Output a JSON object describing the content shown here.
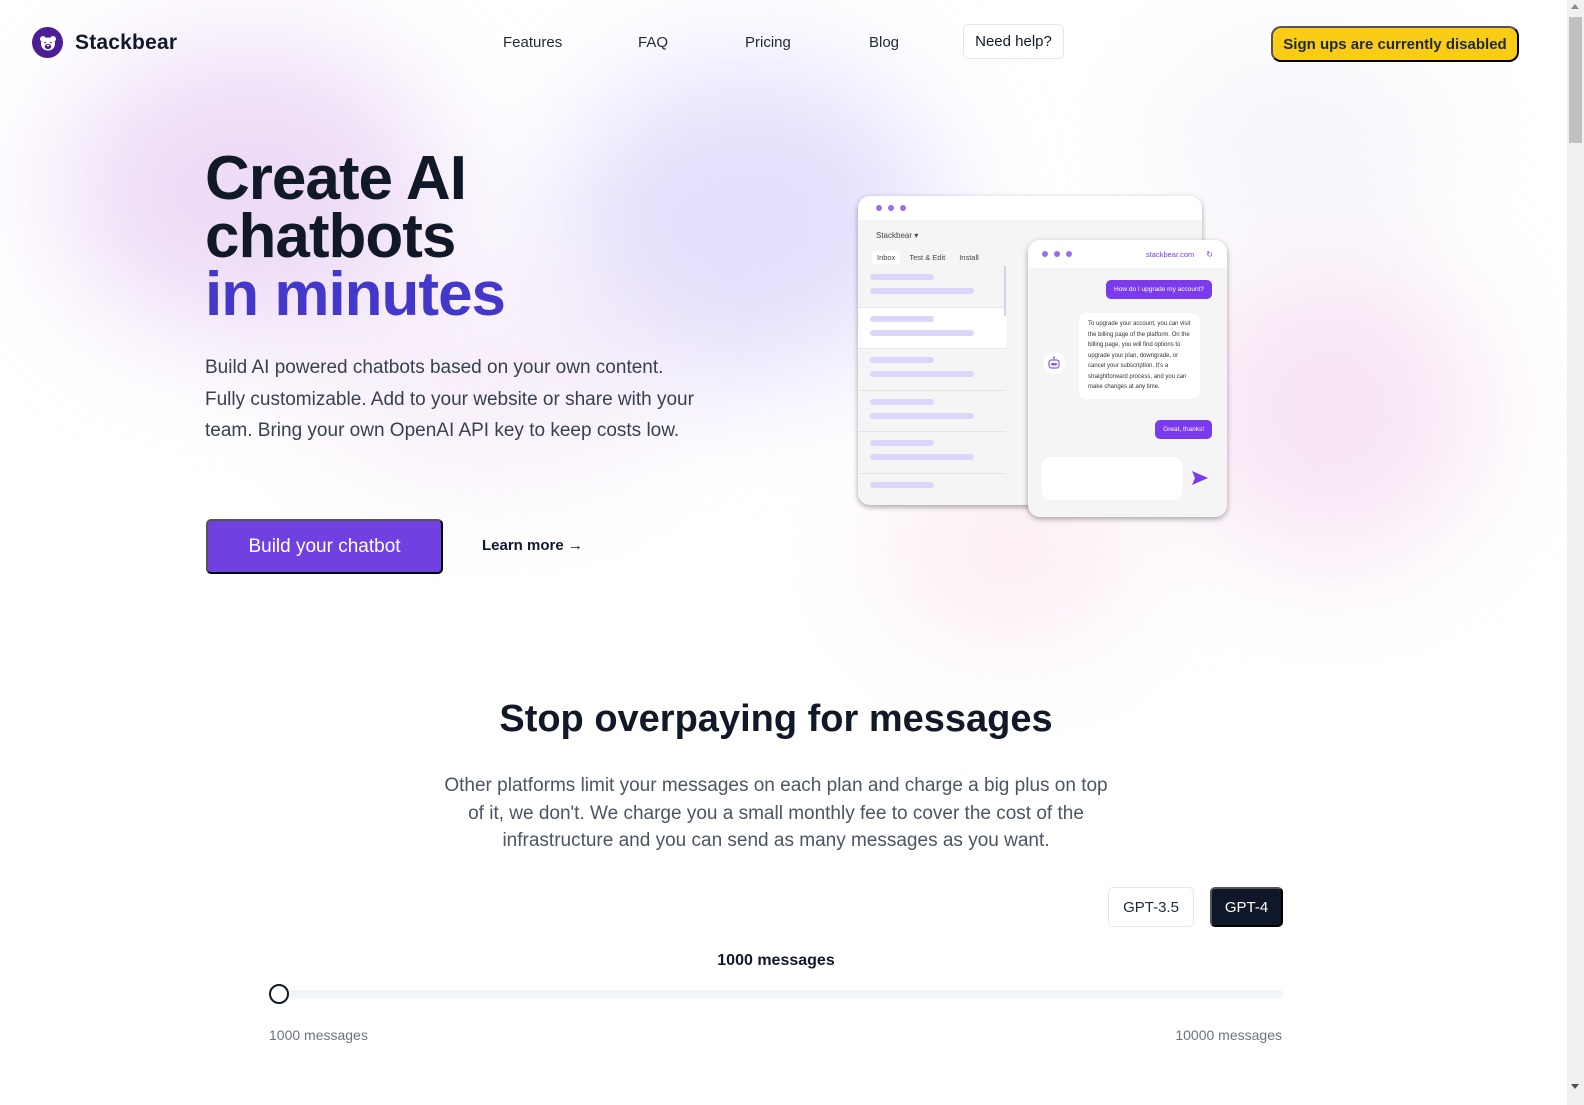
{
  "brand": {
    "name": "Stackbear",
    "logo_icon": "bear-logo-icon"
  },
  "nav": {
    "links": [
      "Features",
      "FAQ",
      "Pricing",
      "Blog"
    ],
    "help_label": "Need help?",
    "signup_label": "Sign ups are currently disabled"
  },
  "hero": {
    "title_line1": "Create AI",
    "title_line2": "chatbots",
    "title_accent": "in minutes",
    "description": "Build AI powered chatbots based on your own content. Fully customizable. Add to your website or share with your team. Bring your own OpenAI API key to keep costs low.",
    "cta_label": "Build your chatbot",
    "learn_more_label": "Learn more →"
  },
  "mockup": {
    "dashboard": {
      "brand": "Stackbear ▾",
      "tabs": [
        "Inbox",
        "Test & Edit",
        "Install"
      ],
      "active_tab": "Inbox"
    },
    "chat": {
      "url": "stackbear.com",
      "user_question": "How do I upgrade my account?",
      "bot_answer": "To upgrade your account, you can visit the billing page of the platform. On the billing page, you will find options to upgrade your plan, downgrade, or cancel your subscription. It's a straightforward process, and you can make changes at any time.",
      "user_reply": "Great, thanks!"
    }
  },
  "pricing": {
    "title": "Stop overpaying for messages",
    "description": "Other platforms limit your messages on each plan and charge a big plus on top of it, we don't. We charge you a small monthly fee to cover the cost of the infrastructure and you can send as many messages as you want.",
    "models": [
      {
        "label": "GPT-3.5",
        "selected": false
      },
      {
        "label": "GPT-4",
        "selected": true
      }
    ],
    "slider": {
      "current_label": "1000 messages",
      "min_label": "1000 messages",
      "max_label": "10000 messages",
      "min": 1000,
      "max": 10000,
      "value": 1000
    }
  },
  "colors": {
    "accent": "#7040e0",
    "title_accent": "#4338ca",
    "signup": "#facc15",
    "dark": "#0f172a"
  }
}
